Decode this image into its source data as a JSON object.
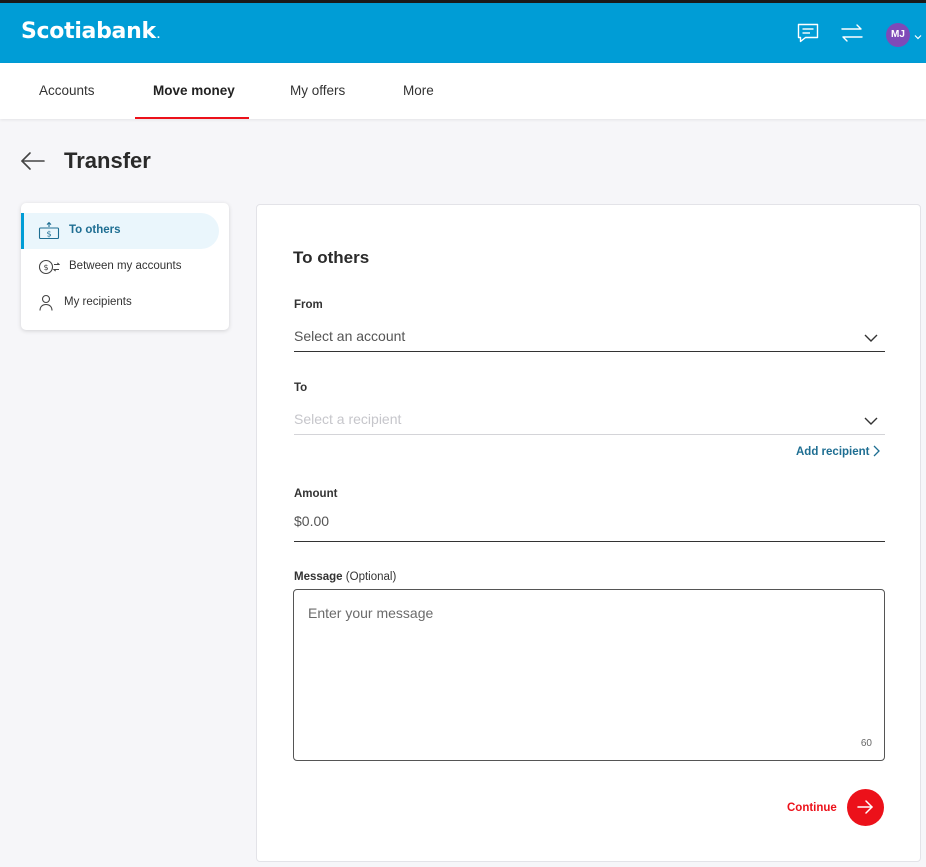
{
  "header": {
    "brand": "Scotiabank",
    "brand_mark": ".",
    "avatar_initials": "MJ",
    "icons": [
      "chat-icon",
      "transfer-icon",
      "chevron-down-icon"
    ],
    "brand_color": "#009dd6",
    "accent_color": "#ec111a"
  },
  "nav": {
    "items": [
      {
        "label": "Accounts"
      },
      {
        "label": "Move money",
        "active": true
      },
      {
        "label": "My offers"
      },
      {
        "label": "More"
      }
    ]
  },
  "page": {
    "title": "Transfer"
  },
  "side_menu": {
    "items": [
      {
        "label": "To others",
        "icon": "money-send-icon",
        "active": true
      },
      {
        "label": "Between my accounts",
        "icon": "dollar-exchange-icon"
      },
      {
        "label": "My recipients",
        "icon": "person-icon"
      }
    ]
  },
  "form": {
    "title": "To others",
    "from": {
      "label": "From",
      "placeholder": "Select an account"
    },
    "to": {
      "label": "To",
      "placeholder": "Select a recipient"
    },
    "add_recipient": "Add recipient",
    "amount": {
      "label": "Amount",
      "value": "$0.00"
    },
    "message": {
      "label": "Message",
      "optional": "(Optional)",
      "placeholder": "Enter your message",
      "char_count": "60"
    },
    "continue_label": "Continue"
  }
}
